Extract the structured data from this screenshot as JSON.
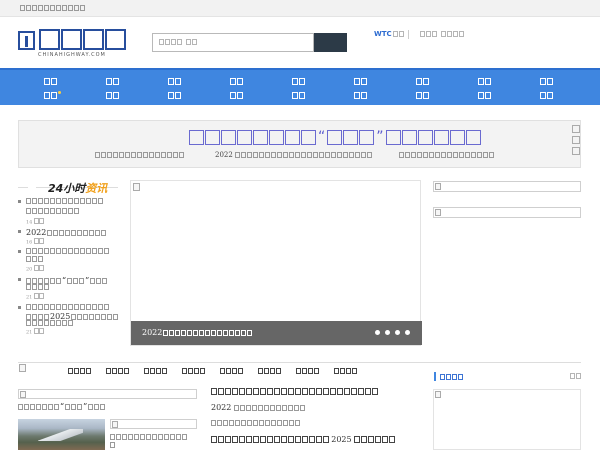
{
  "header": {
    "wtc_label": "WTC",
    "logo_sub": "CHINAHIGHWAY.COM"
  },
  "banner": {
    "subline_year": "2022"
  },
  "news24": {
    "title_prefix": "24小时",
    "title_highlight": "资讯",
    "items": [
      {
        "meta": "14"
      },
      {
        "prefix": "2022",
        "meta": "16"
      },
      {
        "meta": "20"
      },
      {
        "meta": "21"
      },
      {
        "year": "2025",
        "meta": "21"
      }
    ]
  },
  "slider": {
    "caption_year": "2022",
    "slides": 4
  },
  "mid_news": {
    "item2_year": "2022",
    "item5_year": "2025"
  },
  "colors": {
    "nav_bg": "#3f86e0",
    "logo_blue": "#274e9d",
    "accent_orange": "#f1a01a",
    "headline_purple": "#5b5bcf"
  },
  "icons": {
    "logo": "chinahighway-logo-icon",
    "search_button": "search-icon",
    "nav_badge": "hot-dot-icon",
    "broken_image": "broken-image-icon"
  }
}
